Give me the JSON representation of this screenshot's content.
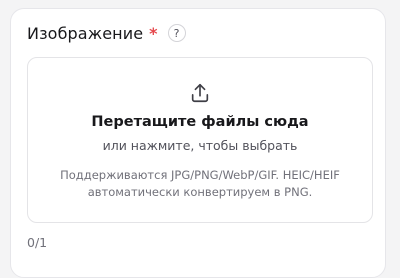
{
  "field": {
    "label": "Изображение",
    "required_mark": "*",
    "help_glyph": "?"
  },
  "dropzone": {
    "icon": "upload-icon",
    "title": "Перетащите файлы сюда",
    "subtitle": "или нажмите, чтобы выбрать",
    "hint_line1": "Поддерживаются JPG/PNG/WebP/GIF. HEIC/HEIF",
    "hint_line2": "автоматически конвертируем в PNG."
  },
  "counter": {
    "text": "0/1"
  },
  "colors": {
    "required": "#e5484d",
    "text_primary": "#18181b",
    "text_muted": "#71717a",
    "border": "#e4e4e7"
  }
}
